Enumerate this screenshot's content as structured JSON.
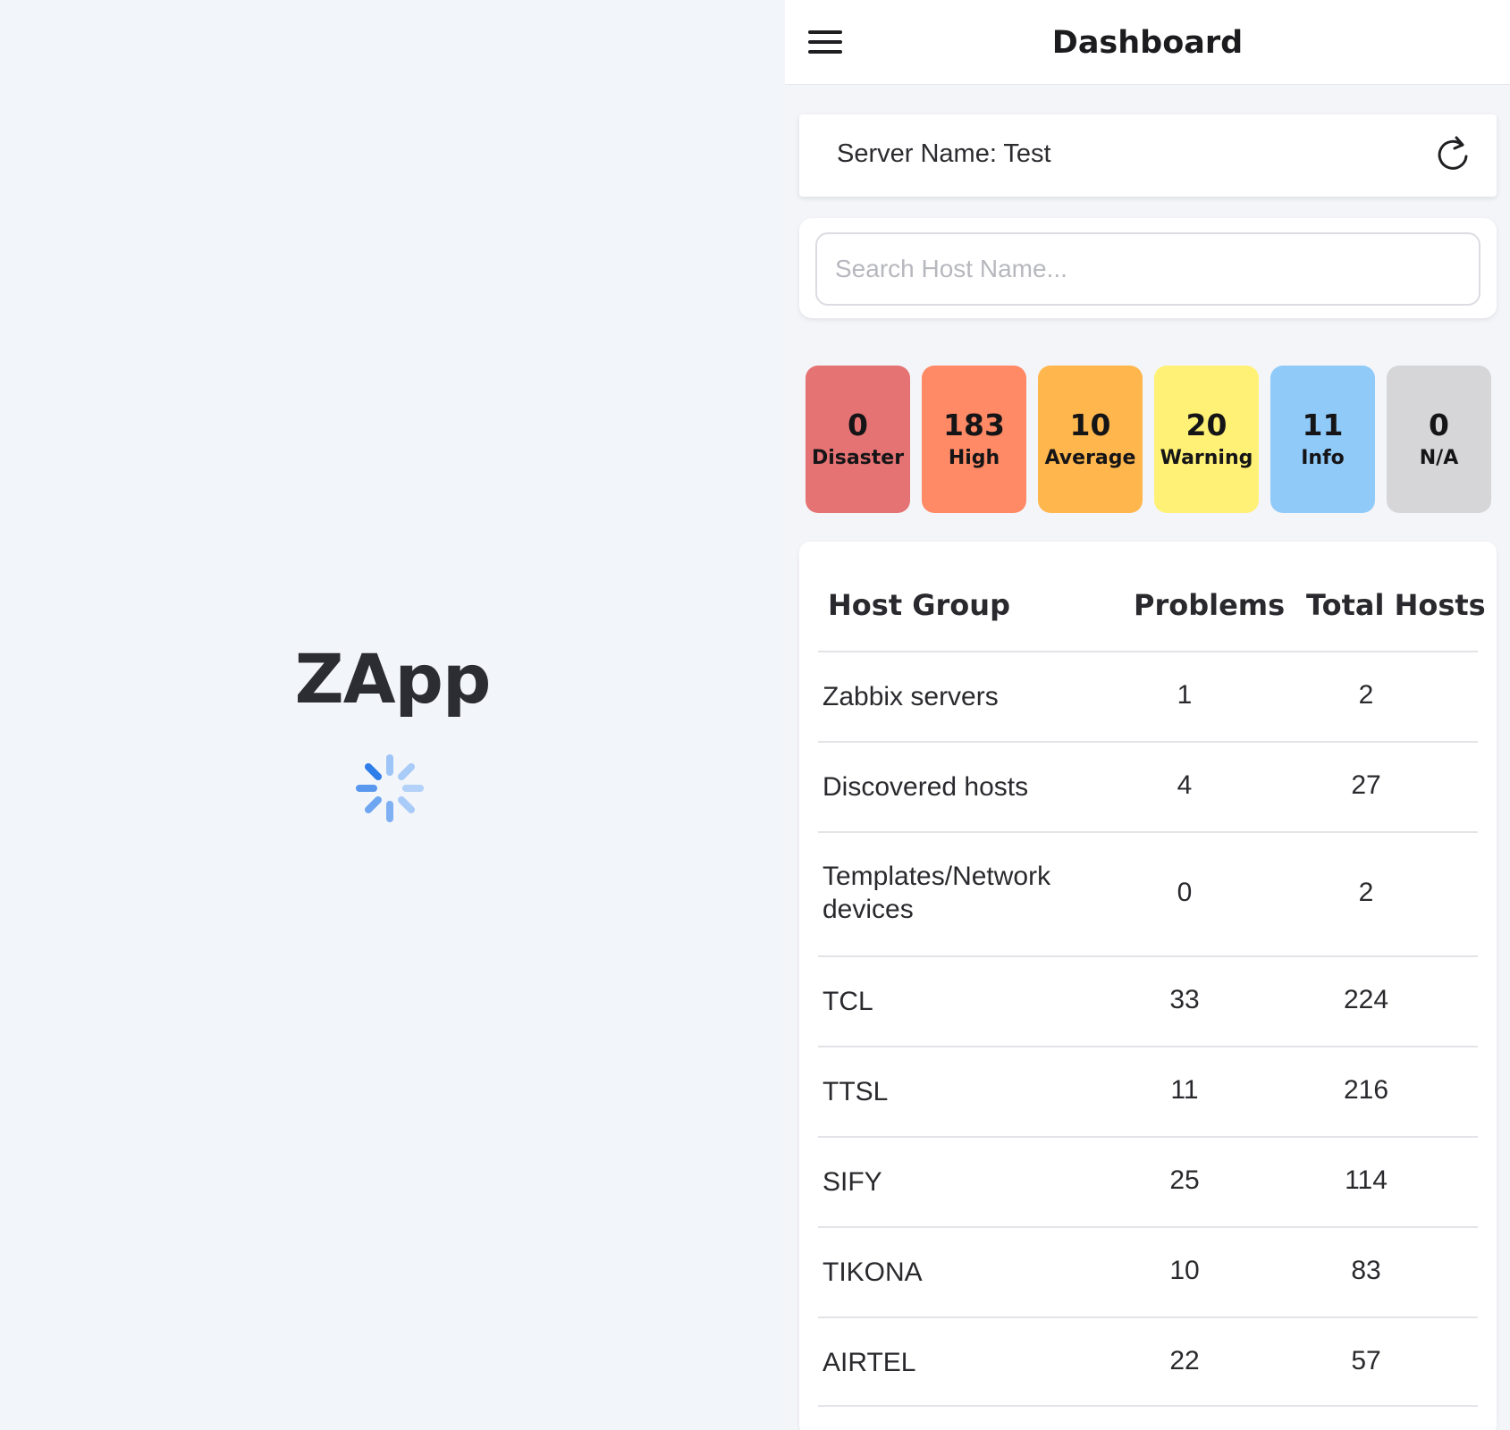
{
  "splash": {
    "app_name": "ZApp",
    "spinner_color": "#4a90f0"
  },
  "header": {
    "title": "Dashboard",
    "menu_icon": "hamburger-menu-icon"
  },
  "server": {
    "label": "Server Name: Test",
    "refresh_icon": "refresh-icon"
  },
  "search": {
    "placeholder": "Search Host Name...",
    "value": ""
  },
  "severities": [
    {
      "count": "0",
      "label": "Disaster",
      "color": "#e57373"
    },
    {
      "count": "183",
      "label": "High",
      "color": "#ff8a65"
    },
    {
      "count": "10",
      "label": "Average",
      "color": "#ffb74d"
    },
    {
      "count": "20",
      "label": "Warning",
      "color": "#fff176"
    },
    {
      "count": "11",
      "label": "Info",
      "color": "#90caf9"
    },
    {
      "count": "0",
      "label": "N/A",
      "color": "#d6d6d8"
    }
  ],
  "table": {
    "headers": {
      "group": "Host Group",
      "problems": "Problems",
      "total": "Total Hosts"
    },
    "rows": [
      {
        "group": "Zabbix servers",
        "problems": "1",
        "total": "2"
      },
      {
        "group": "Discovered hosts",
        "problems": "4",
        "total": "27"
      },
      {
        "group": "Templates/Network devices",
        "problems": "0",
        "total": "2"
      },
      {
        "group": "TCL",
        "problems": "33",
        "total": "224"
      },
      {
        "group": "TTSL",
        "problems": "11",
        "total": "216"
      },
      {
        "group": "SIFY",
        "problems": "25",
        "total": "114"
      },
      {
        "group": "TIKONA",
        "problems": "10",
        "total": "83"
      },
      {
        "group": "AIRTEL",
        "problems": "22",
        "total": "57"
      }
    ]
  }
}
